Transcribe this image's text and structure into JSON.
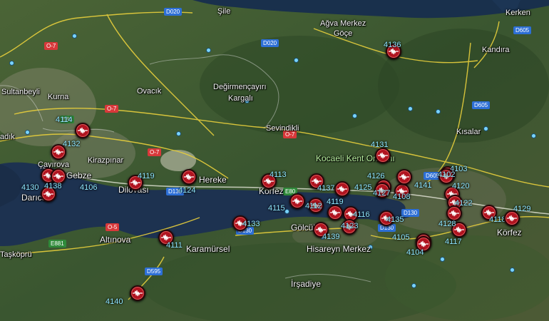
{
  "places": [
    {
      "id": "sile",
      "text": "Şile"
    },
    {
      "id": "agva",
      "text": "Ağva Merkez"
    },
    {
      "id": "goce",
      "text": "Göçe"
    },
    {
      "id": "kerken",
      "text": "Kerken"
    },
    {
      "id": "kandira",
      "text": "Kandıra"
    },
    {
      "id": "sultanbeyli",
      "text": "Sultanbeyli"
    },
    {
      "id": "kurna",
      "text": "Kurna"
    },
    {
      "id": "ovacik",
      "text": "Ovacık"
    },
    {
      "id": "degirmencayiri",
      "text": "Değirmençayırı"
    },
    {
      "id": "kargali",
      "text": "Kargalı"
    },
    {
      "id": "sevindikli",
      "text": "Sevindikli"
    },
    {
      "id": "kisalar",
      "text": "Kısalar"
    },
    {
      "id": "kocaeli",
      "text": "Kocaeli Kent Ormanı"
    },
    {
      "id": "adik",
      "text": "adık"
    },
    {
      "id": "cayirova",
      "text": "Çayırova"
    },
    {
      "id": "kirazpinar",
      "text": "Kirazpınar"
    },
    {
      "id": "gebze",
      "text": "Gebze"
    },
    {
      "id": "darica",
      "text": "Darıca"
    },
    {
      "id": "dilovasi",
      "text": "Dilovası"
    },
    {
      "id": "hereke",
      "text": "Hereke"
    },
    {
      "id": "korfez1",
      "text": "Körfez"
    },
    {
      "id": "korfez2",
      "text": "Körfez"
    },
    {
      "id": "golcuk",
      "text": "Gölcük"
    },
    {
      "id": "hisareyn",
      "text": "Hisareyn Merkez"
    },
    {
      "id": "altinova",
      "text": "Altınova"
    },
    {
      "id": "taskopru",
      "text": "Taşköprü"
    },
    {
      "id": "karamursel",
      "text": "Karamürsel"
    },
    {
      "id": "irsadiye",
      "text": "İrşadiye"
    }
  ],
  "road_shields": [
    {
      "id": "d020a",
      "text": "D020",
      "color": "blue"
    },
    {
      "id": "d020b",
      "text": "D020",
      "color": "blue"
    },
    {
      "id": "d605a",
      "text": "D605",
      "color": "blue"
    },
    {
      "id": "d605b",
      "text": "D605",
      "color": "blue"
    },
    {
      "id": "d605c",
      "text": "D605",
      "color": "blue"
    },
    {
      "id": "o7a",
      "text": "O-7",
      "color": "red"
    },
    {
      "id": "o7b",
      "text": "O-7",
      "color": "red"
    },
    {
      "id": "o7c",
      "text": "O-7",
      "color": "red"
    },
    {
      "id": "o7d",
      "text": "O-7",
      "color": "red"
    },
    {
      "id": "o5",
      "text": "O-5",
      "color": "red"
    },
    {
      "id": "e80a",
      "text": "E80",
      "color": "green"
    },
    {
      "id": "e80b",
      "text": "E80",
      "color": "green"
    },
    {
      "id": "e881",
      "text": "E881",
      "color": "green"
    },
    {
      "id": "d130a",
      "text": "D130",
      "color": "blue"
    },
    {
      "id": "d130b",
      "text": "D130",
      "color": "blue"
    },
    {
      "id": "d130c",
      "text": "D130",
      "color": "blue"
    },
    {
      "id": "d130d",
      "text": "D130",
      "color": "blue"
    },
    {
      "id": "d595",
      "text": "D595",
      "color": "blue"
    }
  ],
  "stations": [
    {
      "code": "4136"
    },
    {
      "code": "4114"
    },
    {
      "code": "4132"
    },
    {
      "code": "4119"
    },
    {
      "code": "4124"
    },
    {
      "code": "4113"
    },
    {
      "code": "4106"
    },
    {
      "code": "4130"
    },
    {
      "code": "4138"
    },
    {
      "code": "4115"
    },
    {
      "code": "4112"
    },
    {
      "code": "4137"
    },
    {
      "code": "4125"
    },
    {
      "code": "4126"
    },
    {
      "code": "4127"
    },
    {
      "code": "4108"
    },
    {
      "code": "4141"
    },
    {
      "code": "4131"
    },
    {
      "code": "4103"
    },
    {
      "code": "4102"
    },
    {
      "code": "4120"
    },
    {
      "code": "4122"
    },
    {
      "code": "4116"
    },
    {
      "code": "4123"
    },
    {
      "code": "4139"
    },
    {
      "code": "4135"
    },
    {
      "code": "4105"
    },
    {
      "code": "4104"
    },
    {
      "code": "4117"
    },
    {
      "code": "4128"
    },
    {
      "code": "4118"
    },
    {
      "code": "4129"
    },
    {
      "code": "4133"
    },
    {
      "code": "4111"
    },
    {
      "code": "4140"
    },
    {
      "code": "4119"
    }
  ],
  "colors": {
    "water": "#1e3350",
    "land": "#3d5a2c",
    "road": "#e8cf3c",
    "marker": "#b01420"
  }
}
